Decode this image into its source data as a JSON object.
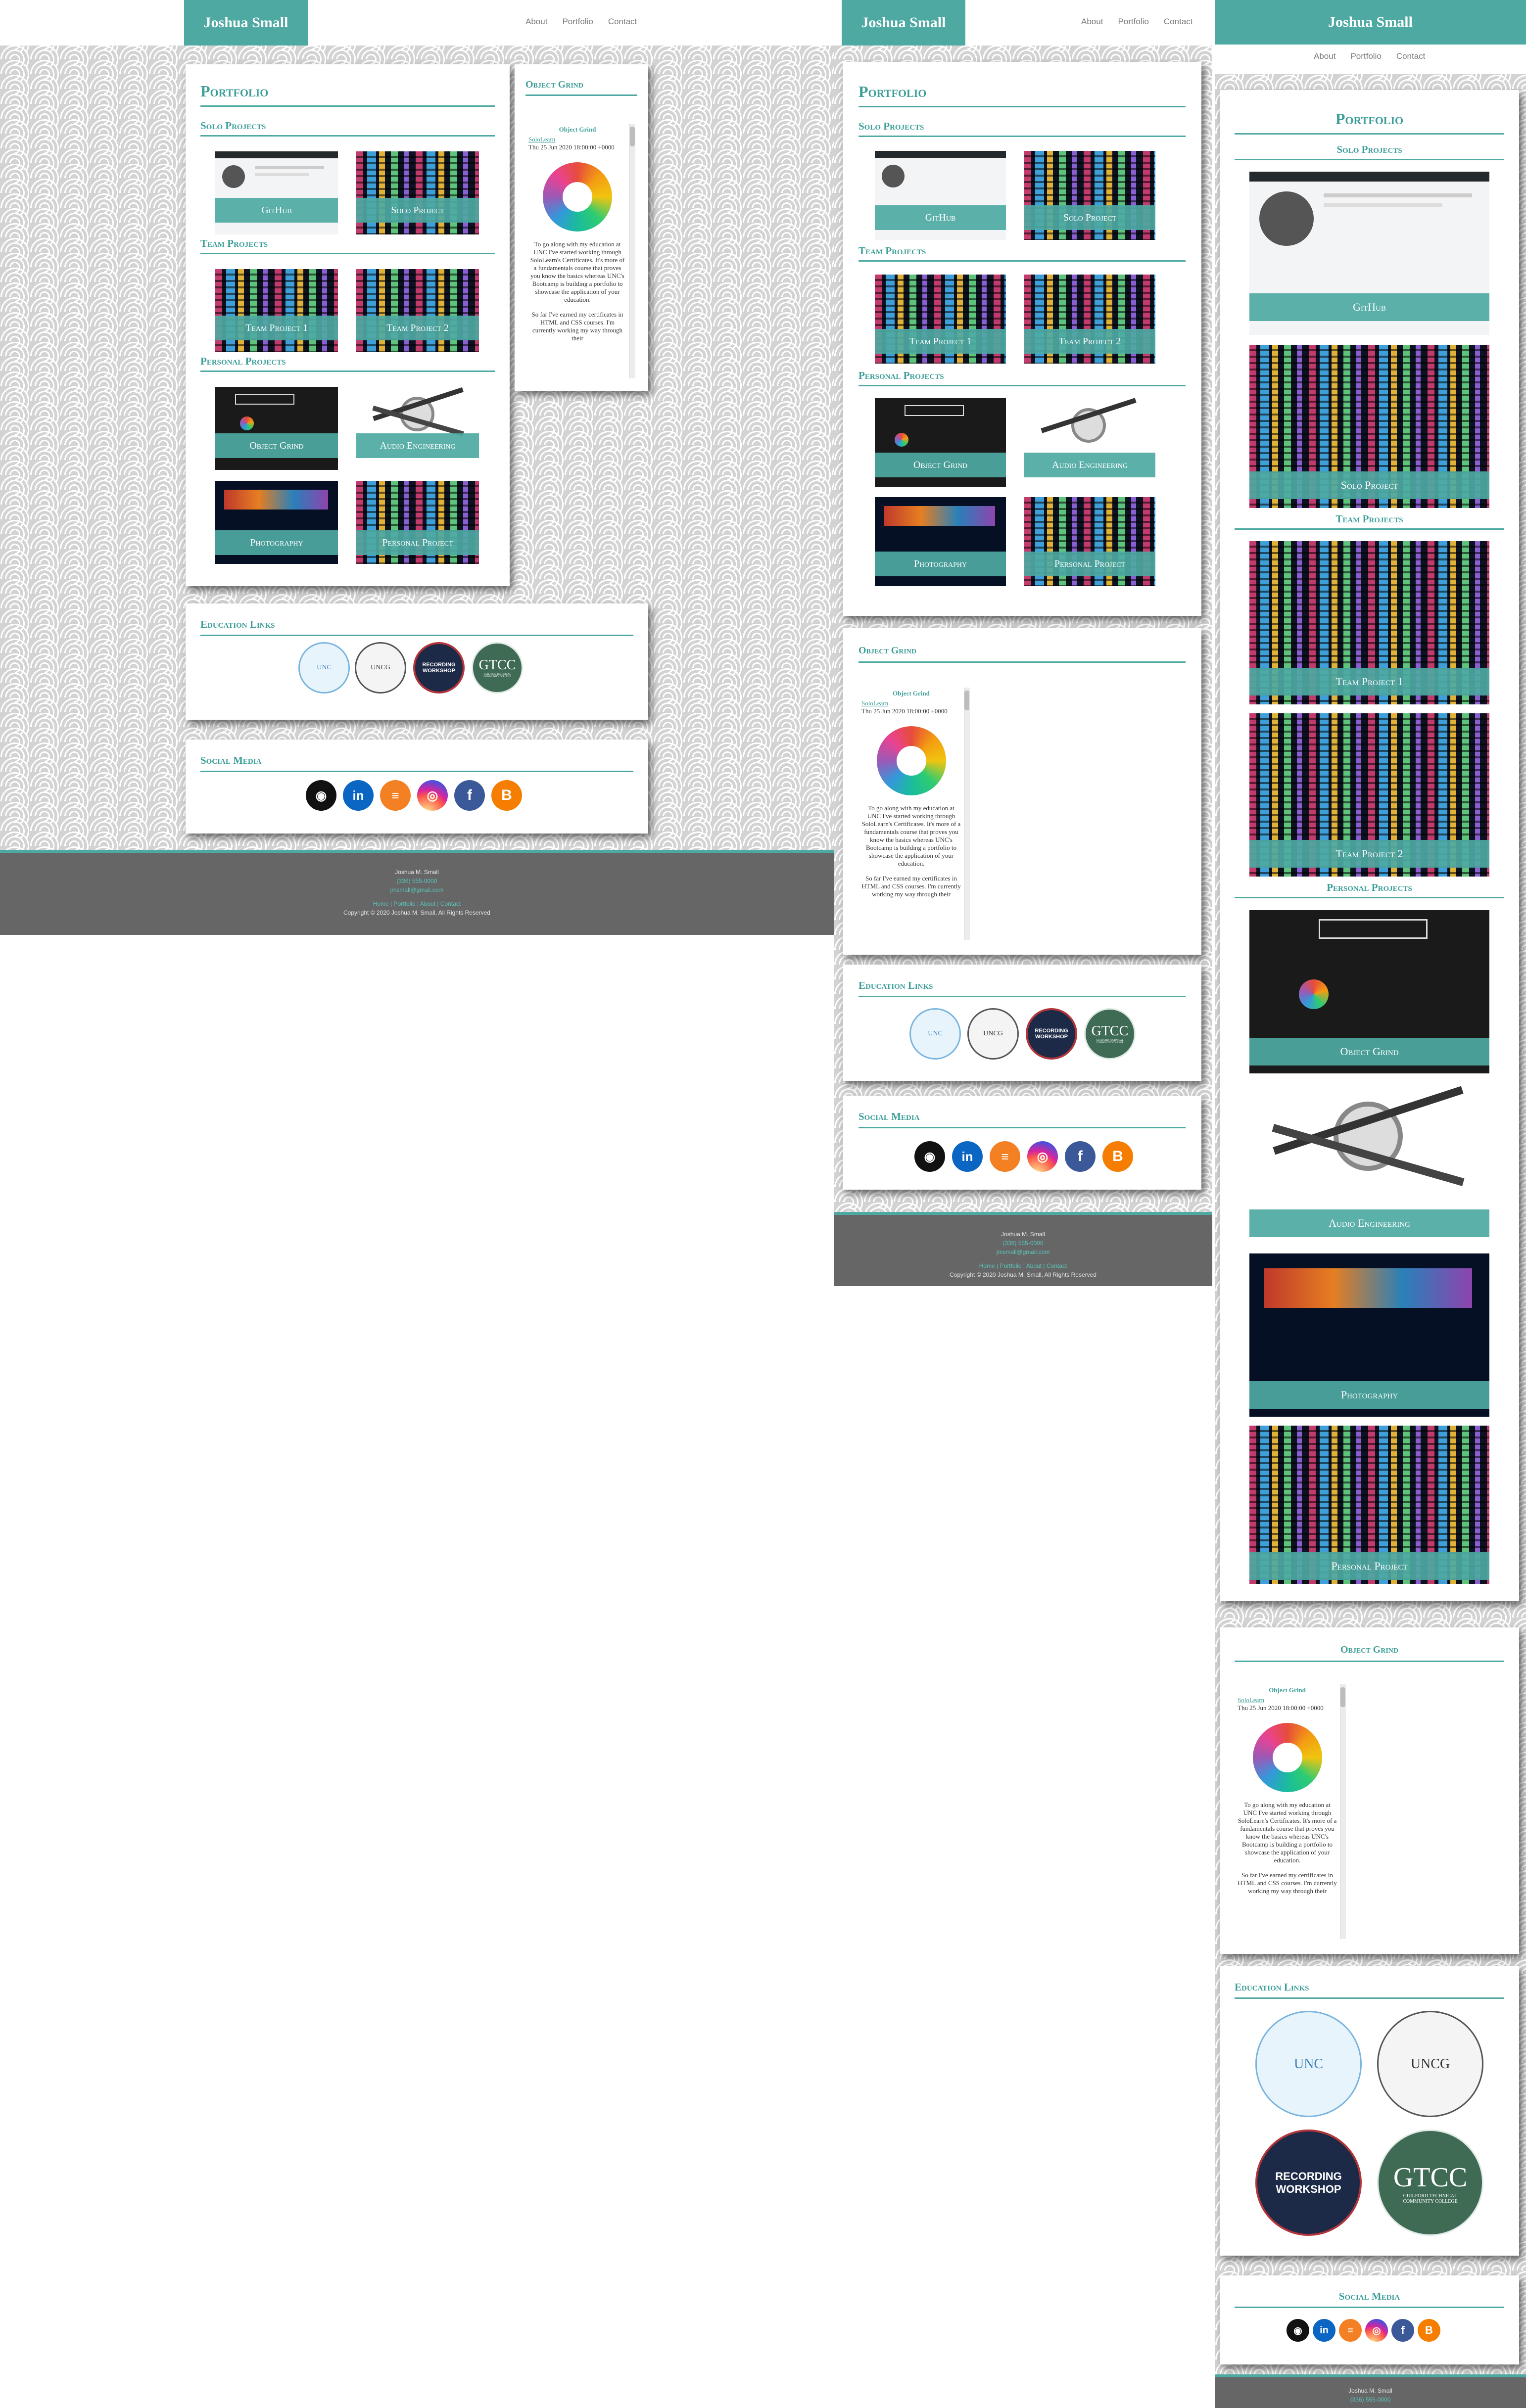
{
  "brand": "Joshua Small",
  "nav": [
    "About",
    "Portfolio",
    "Contact"
  ],
  "portfolio": {
    "title": "Portfolio",
    "sections": [
      "Solo Projects",
      "Team Projects",
      "Personal Projects"
    ],
    "tiles": {
      "github": "GitHub",
      "solo": "Solo Project",
      "team1": "Team Project 1",
      "team2": "Team Project 2",
      "object_grind": "Object Grind",
      "audio": "Audio Engineering",
      "photo": "Photography",
      "personal": "Personal Project"
    }
  },
  "feed": {
    "card_title": "Object Grind",
    "post_title": "Object Grind",
    "link": "SoloLearn",
    "date": "Thu 25 Jun 2020 18:00:00 +0000",
    "para1": "To go along with my education at UNC I've started working through SoloLearn's Certificates. It's more of a fundamentals course that proves you know the basics whereas UNC's Bootcamp is building a portfolio to showcase the application of your education.",
    "para2": "So far I've earned my certificates in HTML and CSS courses. I'm currently working my way through their"
  },
  "education": {
    "title": "Education Links",
    "logos": {
      "unc": "UNC",
      "uncg": "UNCG",
      "rw_line1": "RECORDING",
      "rw_line2": "WORKSHOP",
      "gtcc": "GTCC",
      "gtcc_sub": "GUILFORD TECHNICAL COMMUNITY COLLEGE"
    }
  },
  "social": {
    "title": "Social Media",
    "icons": [
      "github-icon",
      "linkedin-icon",
      "stackoverflow-icon",
      "instagram-icon",
      "facebook-icon",
      "blogger-icon"
    ]
  },
  "footer": {
    "name": "Joshua M. Small",
    "phone": "(336) 555-0000",
    "email": "jmsmall@gmail.com",
    "links": "Home | Portfolio | About | Contact",
    "copyright": "Copyright © 2020 Joshua M. Small, All Rights Reserved"
  },
  "colors": {
    "accent": "#4ea9a3",
    "footer": "#666666",
    "pattern": "#d3d3d3"
  }
}
